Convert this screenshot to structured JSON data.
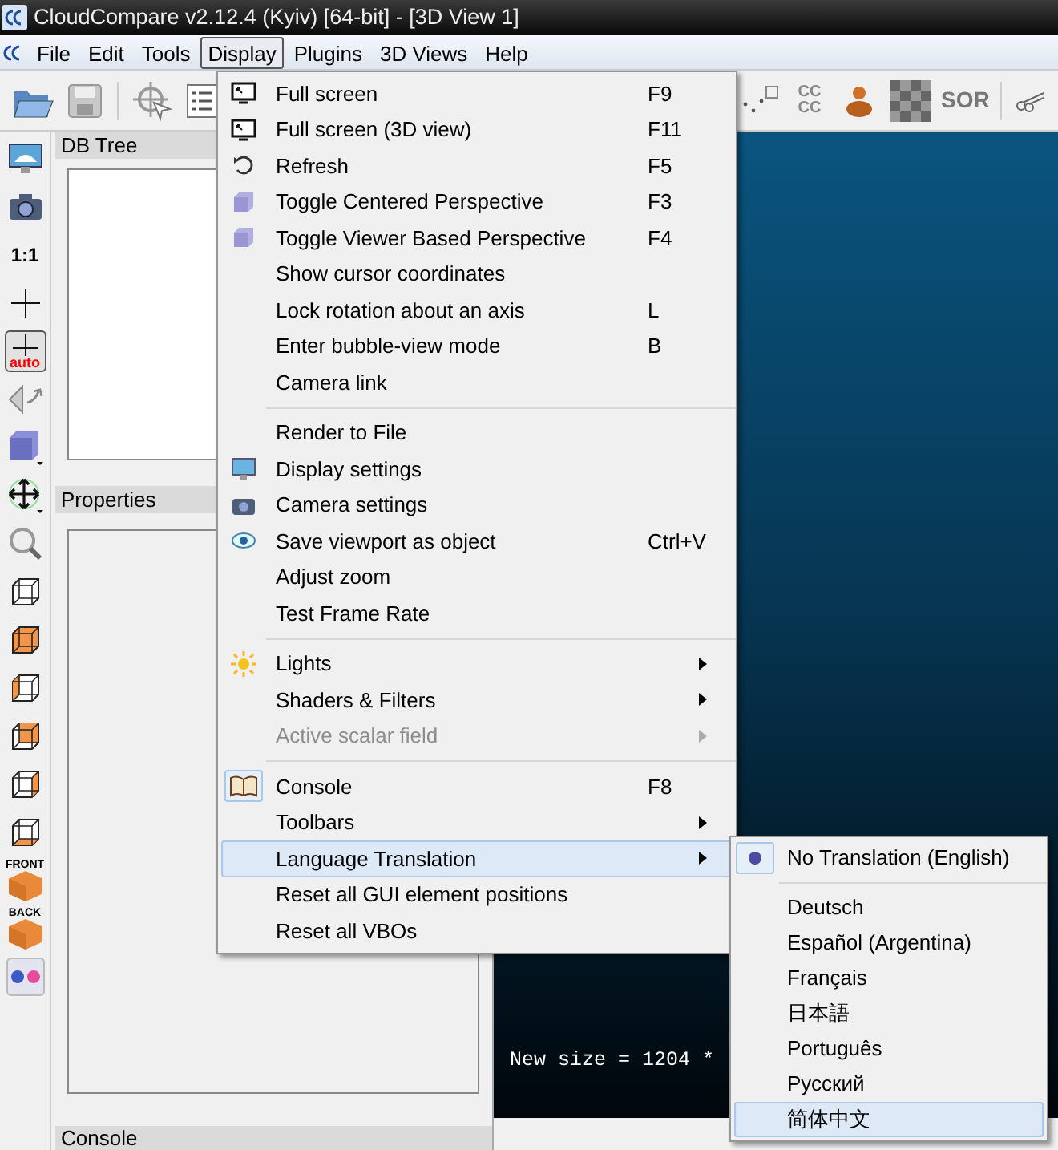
{
  "window": {
    "title": "CloudCompare v2.12.4 (Kyiv) [64-bit] - [3D View 1]"
  },
  "menubar": [
    {
      "label": "File",
      "selected": false
    },
    {
      "label": "Edit",
      "selected": false
    },
    {
      "label": "Tools",
      "selected": false
    },
    {
      "label": "Display",
      "selected": true
    },
    {
      "label": "Plugins",
      "selected": false
    },
    {
      "label": "3D Views",
      "selected": false
    },
    {
      "label": "Help",
      "selected": false
    }
  ],
  "toolbar_right_labels": {
    "compare": "CC CC",
    "sor": "SOR"
  },
  "left_toolbar": [
    {
      "kind": "display"
    },
    {
      "kind": "camera"
    },
    {
      "kind": "text",
      "label": "1:1"
    },
    {
      "kind": "cross"
    },
    {
      "kind": "cross-auto",
      "label": "auto",
      "selected": true
    },
    {
      "kind": "rotate"
    },
    {
      "kind": "cube-blue"
    },
    {
      "kind": "move"
    },
    {
      "kind": "zoom"
    },
    {
      "kind": "cube"
    },
    {
      "kind": "cube-front"
    },
    {
      "kind": "cube-left"
    },
    {
      "kind": "cube-back"
    },
    {
      "kind": "cube-right"
    },
    {
      "kind": "cube-bottom"
    },
    {
      "kind": "cube-label",
      "label": "FRONT"
    },
    {
      "kind": "cube-label",
      "label": "BACK"
    },
    {
      "kind": "dots"
    }
  ],
  "panels": {
    "db_tree": "DB Tree",
    "properties": "Properties",
    "console": "Console"
  },
  "view": {
    "message": "New size = 1204 *"
  },
  "display_menu": [
    {
      "kind": "item",
      "label": "Full screen",
      "shortcut": "F9",
      "checked": false,
      "highlighted": false,
      "disabled": false
    },
    {
      "kind": "item",
      "label": "Full screen (3D view)",
      "shortcut": "F11",
      "checked": false,
      "highlighted": false,
      "disabled": false
    },
    {
      "kind": "item",
      "label": "Refresh",
      "shortcut": "F5",
      "checked": false,
      "highlighted": false,
      "disabled": false
    },
    {
      "kind": "item",
      "label": "Toggle Centered Perspective",
      "shortcut": "F3",
      "checked": false,
      "highlighted": false,
      "disabled": false
    },
    {
      "kind": "item",
      "label": "Toggle Viewer Based Perspective",
      "shortcut": "F4",
      "checked": false,
      "highlighted": false,
      "disabled": false
    },
    {
      "kind": "item",
      "label": "Show cursor coordinates",
      "checked": false,
      "highlighted": false,
      "disabled": false
    },
    {
      "kind": "item",
      "label": "Lock rotation about an axis",
      "shortcut": "L",
      "checked": false,
      "highlighted": false,
      "disabled": false
    },
    {
      "kind": "item",
      "label": "Enter bubble-view mode",
      "shortcut": "B",
      "checked": false,
      "highlighted": false,
      "disabled": false
    },
    {
      "kind": "item",
      "label": "Camera link",
      "checked": false,
      "highlighted": false,
      "disabled": false
    },
    {
      "kind": "separator"
    },
    {
      "kind": "item",
      "label": "Render to File",
      "checked": false,
      "highlighted": false,
      "disabled": false
    },
    {
      "kind": "item",
      "label": "Display settings",
      "checked": false,
      "highlighted": false,
      "disabled": false
    },
    {
      "kind": "item",
      "label": "Camera settings",
      "checked": false,
      "highlighted": false,
      "disabled": false
    },
    {
      "kind": "item",
      "label": "Save viewport as object",
      "shortcut": "Ctrl+V",
      "checked": false,
      "highlighted": false,
      "disabled": false
    },
    {
      "kind": "item",
      "label": "Adjust zoom",
      "checked": false,
      "highlighted": false,
      "disabled": false
    },
    {
      "kind": "item",
      "label": "Test Frame Rate",
      "checked": false,
      "highlighted": false,
      "disabled": false
    },
    {
      "kind": "separator"
    },
    {
      "kind": "submenu",
      "label": "Lights",
      "checked": false,
      "highlighted": false,
      "disabled": false
    },
    {
      "kind": "submenu",
      "label": "Shaders & Filters",
      "checked": false,
      "highlighted": false,
      "disabled": false
    },
    {
      "kind": "submenu",
      "label": "Active scalar field",
      "checked": false,
      "highlighted": false,
      "disabled": true
    },
    {
      "kind": "separator"
    },
    {
      "kind": "item",
      "label": "Console",
      "shortcut": "F8",
      "checked": true,
      "highlighted": false,
      "disabled": false
    },
    {
      "kind": "submenu",
      "label": "Toolbars",
      "checked": false,
      "highlighted": false,
      "disabled": false
    },
    {
      "kind": "submenu",
      "label": "Language Translation",
      "checked": false,
      "highlighted": true,
      "disabled": false
    },
    {
      "kind": "item",
      "label": "Reset all GUI element positions",
      "checked": false,
      "highlighted": false,
      "disabled": false
    },
    {
      "kind": "item",
      "label": "Reset all VBOs",
      "checked": false,
      "highlighted": false,
      "disabled": false
    }
  ],
  "language_menu": [
    {
      "kind": "item",
      "label": "No Translation (English)",
      "checked": true,
      "highlighted": false
    },
    {
      "kind": "separator"
    },
    {
      "kind": "item",
      "label": "Deutsch",
      "checked": false,
      "highlighted": false
    },
    {
      "kind": "item",
      "label": "Español (Argentina)",
      "checked": false,
      "highlighted": false
    },
    {
      "kind": "item",
      "label": "Français",
      "checked": false,
      "highlighted": false
    },
    {
      "kind": "item",
      "label": "日本語",
      "checked": false,
      "highlighted": false
    },
    {
      "kind": "item",
      "label": "Português",
      "checked": false,
      "highlighted": false
    },
    {
      "kind": "item",
      "label": "Русский",
      "checked": false,
      "highlighted": false
    },
    {
      "kind": "item",
      "label": "简体中文",
      "checked": false,
      "highlighted": true
    }
  ]
}
